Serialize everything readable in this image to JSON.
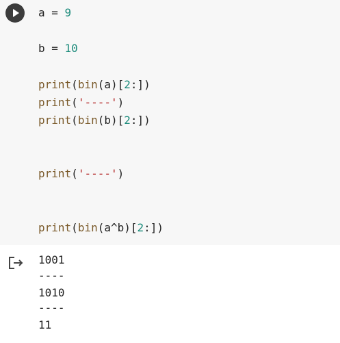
{
  "cell": {
    "run_icon": "play-icon",
    "code_lines": [
      {
        "tokens": [
          {
            "t": "a = ",
            "c": "plain"
          },
          {
            "t": "9",
            "c": "num"
          }
        ]
      },
      {
        "tokens": [
          {
            "t": "b = ",
            "c": "plain"
          },
          {
            "t": "10",
            "c": "num"
          }
        ]
      },
      {
        "tokens": [
          {
            "t": "print",
            "c": "kw"
          },
          {
            "t": "(",
            "c": "plain"
          },
          {
            "t": "bin",
            "c": "kw"
          },
          {
            "t": "(a)[",
            "c": "plain"
          },
          {
            "t": "2",
            "c": "num"
          },
          {
            "t": ":])",
            "c": "plain"
          }
        ]
      },
      {
        "tokens": [
          {
            "t": "print",
            "c": "kw"
          },
          {
            "t": "(",
            "c": "plain"
          },
          {
            "t": "'----'",
            "c": "str"
          },
          {
            "t": ")",
            "c": "plain"
          }
        ]
      },
      {
        "tokens": [
          {
            "t": "print",
            "c": "kw"
          },
          {
            "t": "(",
            "c": "plain"
          },
          {
            "t": "bin",
            "c": "kw"
          },
          {
            "t": "(b)[",
            "c": "plain"
          },
          {
            "t": "2",
            "c": "num"
          },
          {
            "t": ":])",
            "c": "plain"
          }
        ]
      },
      {
        "tokens": [
          {
            "t": "print",
            "c": "kw"
          },
          {
            "t": "(",
            "c": "plain"
          },
          {
            "t": "'----'",
            "c": "str"
          },
          {
            "t": ")",
            "c": "plain"
          }
        ]
      },
      {
        "tokens": [
          {
            "t": "print",
            "c": "kw"
          },
          {
            "t": "(",
            "c": "plain"
          },
          {
            "t": "bin",
            "c": "kw"
          },
          {
            "t": "(a^b)[",
            "c": "plain"
          },
          {
            "t": "2",
            "c": "num"
          },
          {
            "t": ":])",
            "c": "plain"
          }
        ]
      }
    ]
  },
  "output": {
    "icon": "output-redirect-icon",
    "lines": [
      "1001",
      "----",
      "1010",
      "----",
      "11"
    ]
  },
  "colors": {
    "keyword": "#7a5a2a",
    "number": "#1a8a7a",
    "string": "#b22222",
    "cell_bg": "#f7f7f7"
  }
}
